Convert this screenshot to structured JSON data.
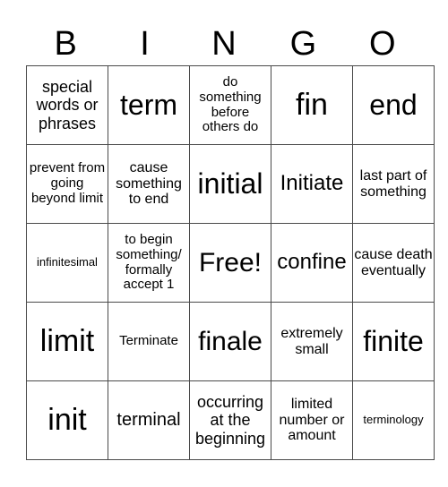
{
  "header": [
    "B",
    "I",
    "N",
    "G",
    "O"
  ],
  "rows": [
    [
      "special words or phrases",
      "term",
      "do something before others do",
      "fin",
      "end"
    ],
    [
      "prevent from going beyond limit",
      "cause something to end",
      "initial",
      "Initiate",
      "last part of something"
    ],
    [
      "infinitesimal",
      "to begin something/ formally accept 1",
      "Free!",
      "confine",
      "cause death eventually"
    ],
    [
      "limit",
      "Terminate",
      "finale",
      "extremely small",
      "finite"
    ],
    [
      "init",
      "terminal",
      "occurring at the beginning",
      "limited number or amount",
      "terminology"
    ]
  ]
}
